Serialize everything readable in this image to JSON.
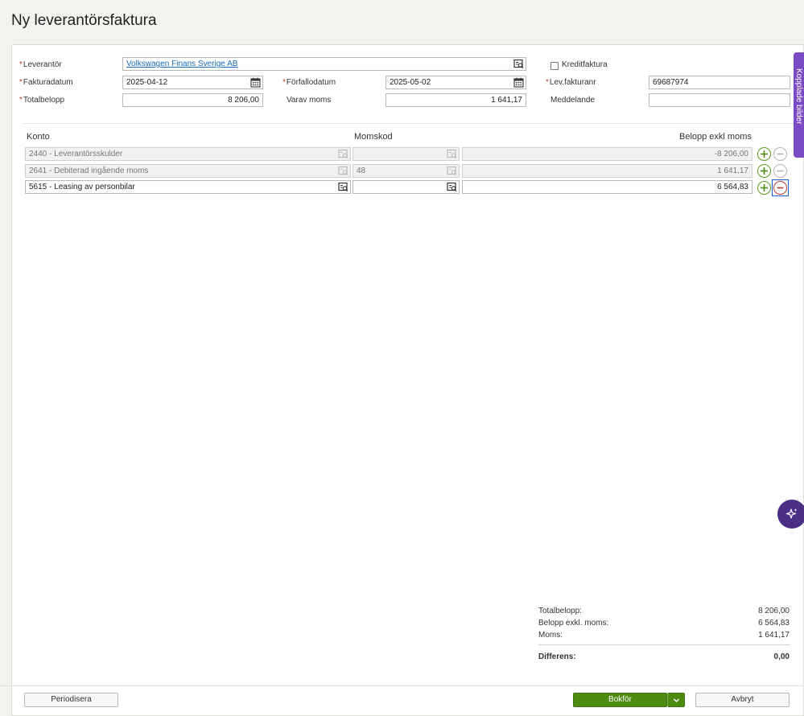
{
  "page": {
    "title": "Ny leverantörsfaktura"
  },
  "header_form": {
    "required_mark": "*",
    "supplier": {
      "label": "Leverantör",
      "value": "Volkswagen Finans Sverige AB"
    },
    "credit_invoice": {
      "label": "Kreditfaktura",
      "checked": false
    },
    "invoice_date": {
      "label": "Fakturadatum",
      "value": "2025-04-12"
    },
    "due_date": {
      "label": "Förfallodatum",
      "value": "2025-05-02"
    },
    "supplier_invoice_no": {
      "label": "Lev.fakturanr",
      "value": "69687974"
    },
    "total_amount": {
      "label": "Totalbelopp",
      "value": "8 206,00"
    },
    "vat_amount": {
      "label": "Varav moms",
      "value": "1 641,17"
    },
    "message": {
      "label": "Meddelande",
      "value": ""
    }
  },
  "lines": {
    "columns": [
      "Konto",
      "Momskod",
      "Belopp exkl moms"
    ],
    "rows": [
      {
        "account": "2440 - Leverantörsskulder",
        "vat_code": "",
        "amount": "-8 206,00",
        "editable": false
      },
      {
        "account": "2641 - Debiterad ingående moms",
        "vat_code": "48",
        "amount": "1 641,17",
        "editable": false
      },
      {
        "account": "5615 - Leasing av personbilar",
        "vat_code": "",
        "amount": "6 564,83",
        "editable": true
      }
    ]
  },
  "summary": {
    "total_label": "Totalbelopp:",
    "total_value": "8 206,00",
    "excl_label": "Belopp exkl. moms:",
    "excl_value": "6 564,83",
    "vat_label": "Moms:",
    "vat_value": "1 641,17",
    "diff_label": "Differens:",
    "diff_value": "0,00"
  },
  "footer": {
    "periodize_label": "Periodisera",
    "post_label": "Bokför",
    "cancel_label": "Avbryt"
  },
  "side_tab": {
    "label": "Kopplade bilder"
  },
  "colors": {
    "primary": "#4d8a12",
    "side_tab": "#7b4bc4",
    "ai_button": "#4a2f86",
    "link": "#1a6bb8"
  },
  "icons": [
    "lookup-icon",
    "calendar-icon",
    "plus-icon",
    "minus-icon",
    "sparkle-icon",
    "chevron-down-icon"
  ]
}
